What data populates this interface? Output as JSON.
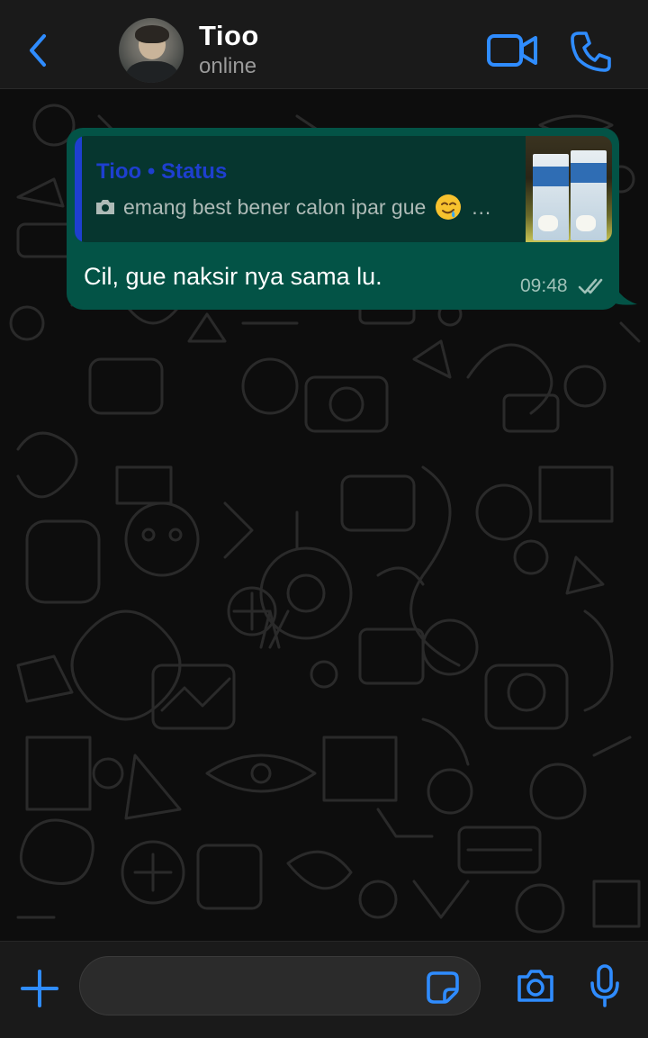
{
  "header": {
    "contact_name": "Tioo",
    "contact_status": "online",
    "accent_color": "#2f8cff",
    "icons": [
      "chevron-left-icon",
      "video-camera-icon",
      "phone-icon"
    ]
  },
  "chat": {
    "messages": [
      {
        "direction": "outgoing",
        "reply_to": {
          "author": "Tioo • Status",
          "text": "emang best bener calon ipar gue",
          "ellipsis": "…",
          "emoji": "drooling-face",
          "media_icon": "camera-icon"
        },
        "text": "Cil, gue naksir nya sama lu.",
        "time": "09:48",
        "status": "read",
        "bubble_color": "#035346"
      }
    ]
  },
  "input_bar": {
    "placeholder": "",
    "icons": [
      "plus-icon",
      "sticker-icon",
      "camera-icon",
      "microphone-icon"
    ]
  }
}
